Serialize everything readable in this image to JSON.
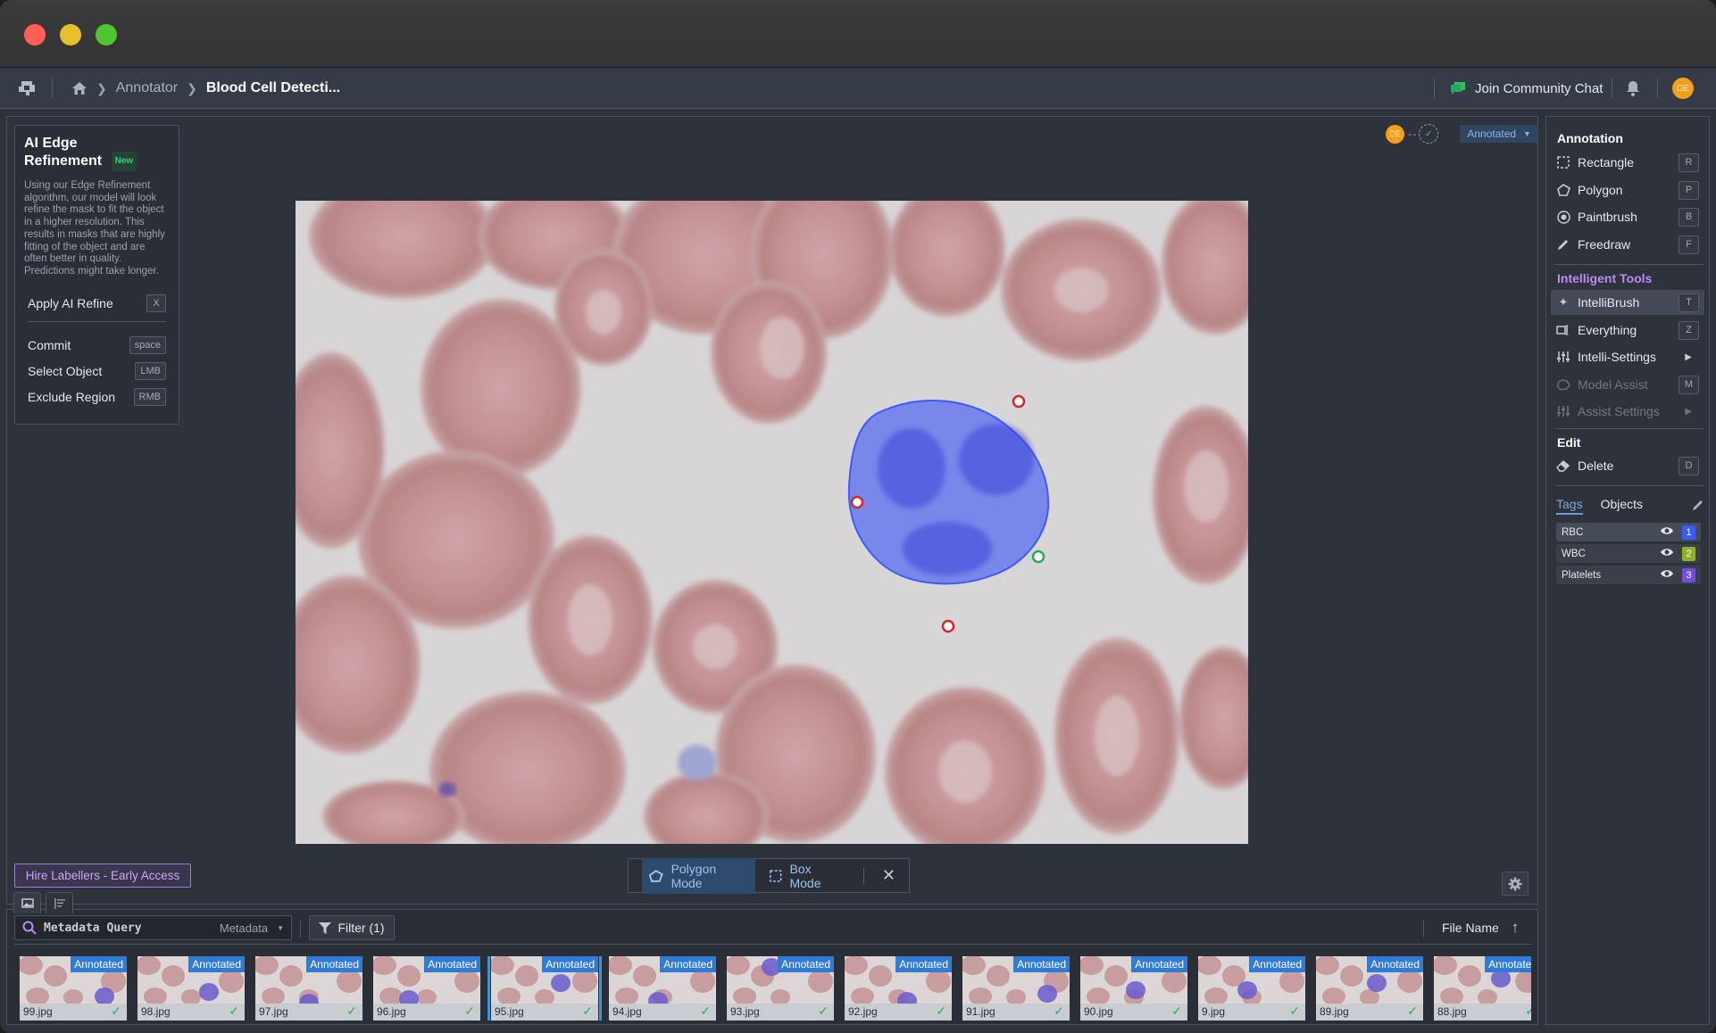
{
  "window": {
    "controls": [
      "close",
      "minimize",
      "maximize"
    ]
  },
  "nav": {
    "logo_icon": "app-logo-icon",
    "home_icon": "home-icon",
    "breadcrumb": [
      "Annotator",
      "Blood Cell Detecti..."
    ],
    "community_label": "Join Community Chat",
    "community_icon": "chat-bubbles-icon",
    "bell_icon": "bell-icon",
    "user_initials": "DE"
  },
  "refine_panel": {
    "title": "AI Edge Refinement",
    "title_line1": "AI Edge",
    "title_line2": "Refinement",
    "badge": "New",
    "description": "Using our Edge Refinement algorithm, our model will look refine the mask to fit the object in a higher resolution. This results in masks that are highly fitting of the object and are often better in quality. Predictions might take longer.",
    "apply": {
      "label": "Apply AI Refine",
      "key": "X"
    },
    "shortcuts": [
      {
        "label": "Commit",
        "key": "space"
      },
      {
        "label": "Select Object",
        "key": "LMB"
      },
      {
        "label": "Exclude Region",
        "key": "RMB"
      }
    ]
  },
  "status": {
    "assignee_initials": "DE",
    "review_icon": "check-circle-icon",
    "value": "Annotated"
  },
  "canvas": {
    "image_subject": "Blood smear with red blood cells and a white blood cell",
    "mask_color": "#4f6cf7",
    "negative_point_color": "#d4312e",
    "positive_point_color": "#27a85a"
  },
  "hire_button": "Hire Labellers - Early Access",
  "mode_bar": {
    "polygon": "Polygon Mode",
    "box": "Box Mode",
    "active": "Polygon Mode"
  },
  "gallery": {
    "view_tabs": [
      "image-grid-icon",
      "list-icon"
    ],
    "search_placeholder": "Metadata Query",
    "search_scope": "Metadata",
    "filter_label": "Filter (1)",
    "sort_label": "File Name",
    "sort_dir": "ascending",
    "thumbnails": [
      {
        "name": "99.jpg",
        "status": "Annotated",
        "selected": false
      },
      {
        "name": "98.jpg",
        "status": "Annotated",
        "selected": false
      },
      {
        "name": "97.jpg",
        "status": "Annotated",
        "selected": false
      },
      {
        "name": "96.jpg",
        "status": "Annotated",
        "selected": false
      },
      {
        "name": "95.jpg",
        "status": "Annotated",
        "selected": true
      },
      {
        "name": "94.jpg",
        "status": "Annotated",
        "selected": false
      },
      {
        "name": "93.jpg",
        "status": "Annotated",
        "selected": false
      },
      {
        "name": "92.jpg",
        "status": "Annotated",
        "selected": false
      },
      {
        "name": "91.jpg",
        "status": "Annotated",
        "selected": false
      },
      {
        "name": "90.jpg",
        "status": "Annotated",
        "selected": false
      },
      {
        "name": "9.jpg",
        "status": "Annotated",
        "selected": false
      },
      {
        "name": "89.jpg",
        "status": "Annotated",
        "selected": false
      },
      {
        "name": "88.jpg",
        "status": "Annotated",
        "selected": false
      }
    ]
  },
  "tools": {
    "annotation_heading": "Annotation",
    "annotation": [
      {
        "label": "Rectangle",
        "key": "R",
        "icon": "rectangle-icon"
      },
      {
        "label": "Polygon",
        "key": "P",
        "icon": "polygon-icon"
      },
      {
        "label": "Paintbrush",
        "key": "B",
        "icon": "paintbrush-icon"
      },
      {
        "label": "Freedraw",
        "key": "F",
        "icon": "pencil-icon"
      }
    ],
    "intelligent_heading": "Intelligent Tools",
    "intelligent": [
      {
        "label": "IntelliBrush",
        "key": "T",
        "icon": "sparkle-icon",
        "active": true
      },
      {
        "label": "Everything",
        "key": "Z",
        "icon": "everything-icon"
      },
      {
        "label": "Intelli-Settings",
        "submenu": true,
        "icon": "sliders-icon"
      },
      {
        "label": "Model Assist",
        "key": "M",
        "icon": "brain-icon",
        "disabled": true
      },
      {
        "label": "Assist Settings",
        "submenu": true,
        "icon": "sliders-icon",
        "disabled": true
      }
    ],
    "edit_heading": "Edit",
    "edit": [
      {
        "label": "Delete",
        "key": "D",
        "icon": "eraser-icon"
      }
    ]
  },
  "classes": {
    "tabs": [
      "Tags",
      "Objects"
    ],
    "active_tab": "Tags",
    "items": [
      {
        "name": "RBC",
        "num": "1",
        "color": "#3a5cf5"
      },
      {
        "name": "WBC",
        "num": "2",
        "color": "#8db22a"
      },
      {
        "name": "Platelets",
        "num": "3",
        "color": "#7150d6"
      }
    ]
  }
}
